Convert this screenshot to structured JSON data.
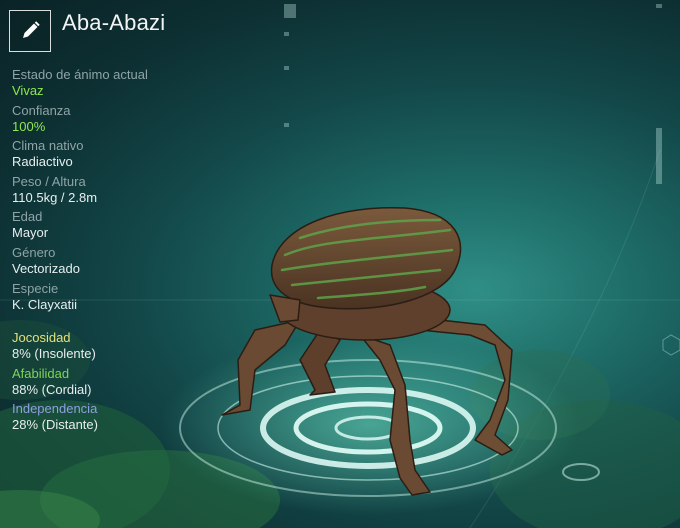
{
  "creature": {
    "name": "Aba-Abazi"
  },
  "edit": {
    "icon": "pencil-icon"
  },
  "stats": [
    {
      "label": "Estado de ánimo actual",
      "value": "Vivaz",
      "highlight": true
    },
    {
      "label": "Confianza",
      "value": "100%",
      "highlight": true
    },
    {
      "label": "Clima nativo",
      "value": "Radiactivo",
      "highlight": false
    },
    {
      "label": "Peso / Altura",
      "value": "110.5kg / 2.8m",
      "highlight": false
    },
    {
      "label": "Edad",
      "value": "Mayor",
      "highlight": false
    },
    {
      "label": "Género",
      "value": "Vectorizado",
      "highlight": false
    },
    {
      "label": "Especie",
      "value": "K. Clayxatii",
      "highlight": false
    }
  ],
  "traits": [
    {
      "label": "Jocosidad",
      "value": "8% (Insolente)",
      "color": "#e3e27a"
    },
    {
      "label": "Afabilidad",
      "value": "88% (Cordial)",
      "color": "#7fd35a"
    },
    {
      "label": "Independencia",
      "value": "28% (Distante)",
      "color": "#8f9fe0"
    }
  ]
}
